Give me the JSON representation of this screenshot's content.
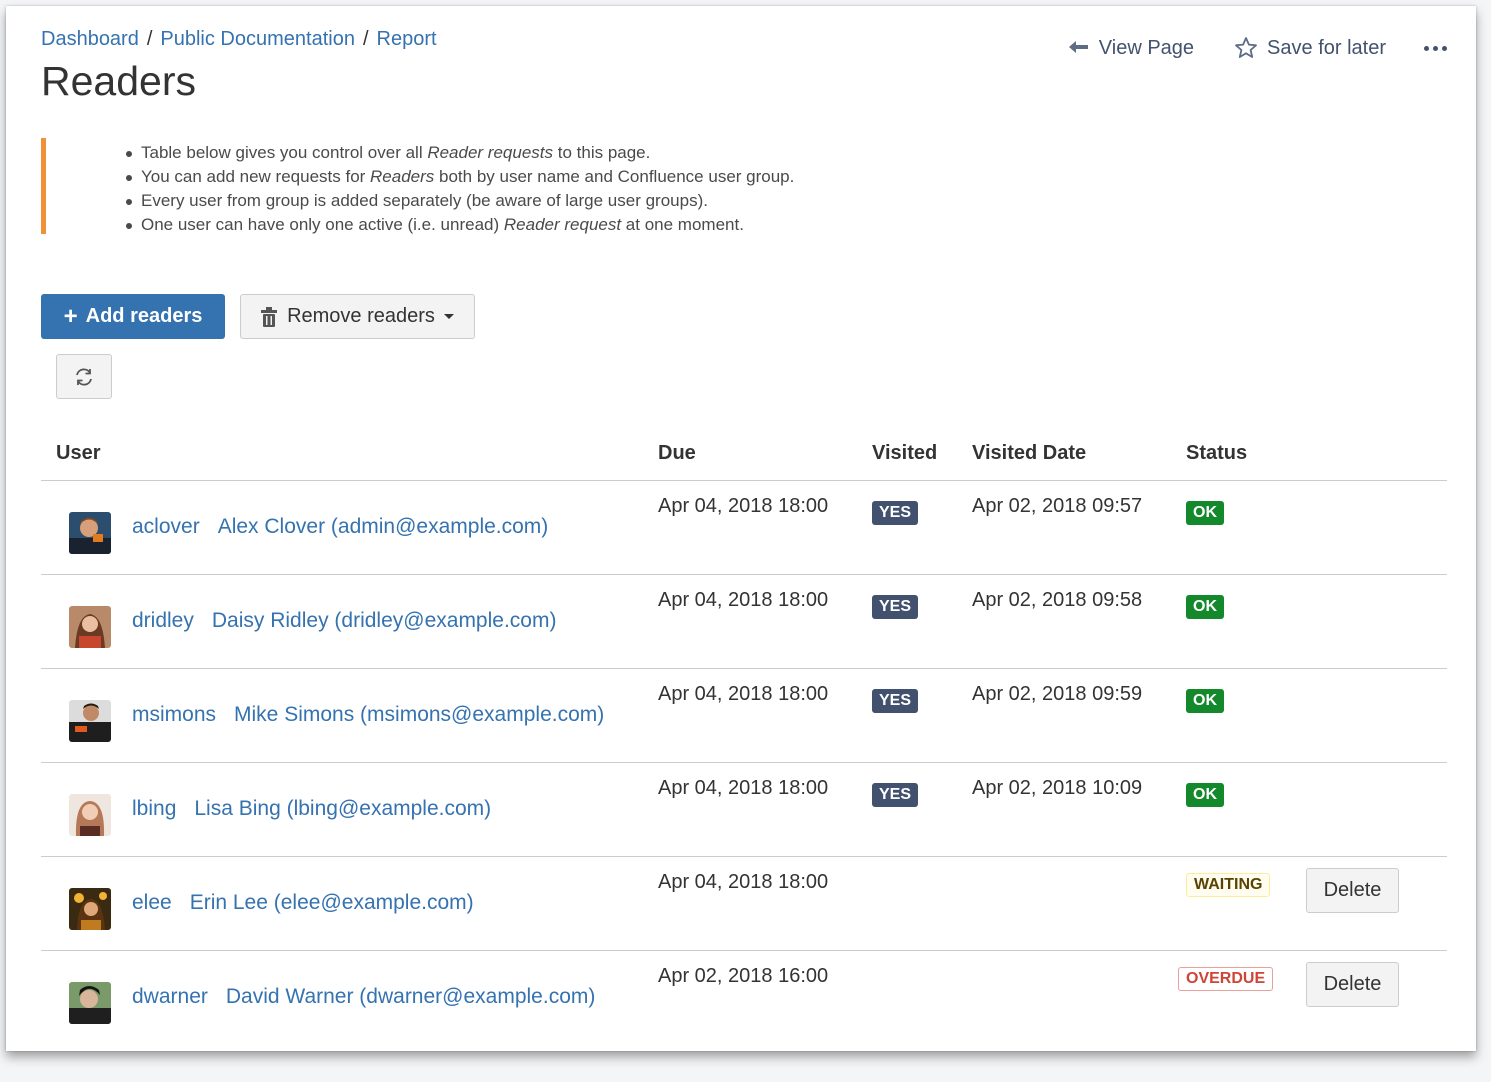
{
  "breadcrumb": [
    "Dashboard",
    "Public Documentation",
    "Report"
  ],
  "title": "Readers",
  "actions": {
    "view_page": "View Page",
    "save_later": "Save for later"
  },
  "info": {
    "items": [
      {
        "pre": "Table below gives you control over all ",
        "em": "Reader requests",
        "post": " to this page."
      },
      {
        "pre": "You can add new requests for ",
        "em": "Readers",
        "post": " both by user name and Confluence user group."
      },
      {
        "pre": "Every user from group is added separately (be aware of large user groups).",
        "em": "",
        "post": ""
      },
      {
        "pre": "One user can have only one active (i.e. unread) ",
        "em": "Reader request",
        "post": " at one moment."
      }
    ]
  },
  "buttons": {
    "add": "Add readers",
    "remove": "Remove readers",
    "delete": "Delete"
  },
  "table": {
    "headers": {
      "user": "User",
      "due": "Due",
      "visited": "Visited",
      "visited_date": "Visited Date",
      "status": "Status"
    },
    "rows": [
      {
        "username": "aclover",
        "fullname": "Alex Clover (admin@example.com)",
        "due": "Apr 04, 2018 18:00",
        "visited": "YES",
        "visited_date": "Apr 02, 2018 09:57",
        "status": "OK",
        "avatar_color": "#2b4d6e"
      },
      {
        "username": "dridley",
        "fullname": "Daisy Ridley (dridley@example.com)",
        "due": "Apr 04, 2018 18:00",
        "visited": "YES",
        "visited_date": "Apr 02, 2018 09:58",
        "status": "OK",
        "avatar_color": "#8a5a44"
      },
      {
        "username": "msimons",
        "fullname": "Mike Simons (msimons@example.com)",
        "due": "Apr 04, 2018 18:00",
        "visited": "YES",
        "visited_date": "Apr 02, 2018 09:59",
        "status": "OK",
        "avatar_color": "#222222"
      },
      {
        "username": "lbing",
        "fullname": "Lisa Bing (lbing@example.com)",
        "due": "Apr 04, 2018 18:00",
        "visited": "YES",
        "visited_date": "Apr 02, 2018 10:09",
        "status": "OK",
        "avatar_color": "#c9a38a"
      },
      {
        "username": "elee",
        "fullname": "Erin Lee (elee@example.com)",
        "due": "Apr 04, 2018 18:00",
        "visited": "",
        "visited_date": "",
        "status": "WAITING",
        "avatar_color": "#6b4a1e"
      },
      {
        "username": "dwarner",
        "fullname": "David Warner (dwarner@example.com)",
        "due": "Apr 02, 2018 16:00",
        "visited": "",
        "visited_date": "",
        "status": "OVERDUE",
        "avatar_color": "#1f1f1f"
      }
    ]
  }
}
